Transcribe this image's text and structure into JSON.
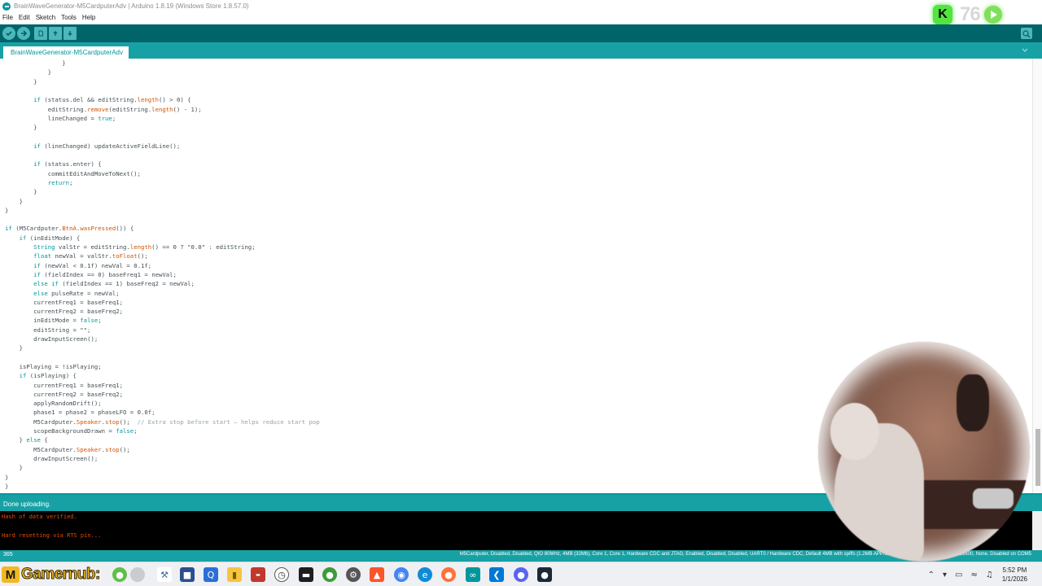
{
  "window": {
    "title": "BrainWaveGenerator-M5CardputerAdv | Arduino 1.8.19 (Windows Store 1.8.57.0)"
  },
  "menu": [
    "File",
    "Edit",
    "Sketch",
    "Tools",
    "Help"
  ],
  "overlay": {
    "badge_letter": "K",
    "counter": "76"
  },
  "toolbar": {
    "verify_icon": "check-icon",
    "upload_icon": "arrow-right-icon",
    "new_icon": "new-file-icon",
    "open_icon": "open-arrow-icon",
    "save_icon": "save-arrow-icon",
    "serial_icon": "magnifier-icon"
  },
  "tab": {
    "label": "BrainWaveGenerator-M5CardputerAdv"
  },
  "code": {
    "lines": [
      "                }",
      "            }",
      "        }",
      "",
      "        if (status.del && editString.length() > 0) {",
      "            editString.remove(editString.length() - 1);",
      "            lineChanged = true;",
      "        }",
      "",
      "        if (lineChanged) updateActiveFieldLine();",
      "",
      "        if (status.enter) {",
      "            commitEditAndMoveToNext();",
      "            return;",
      "        }",
      "    }",
      "}",
      "",
      "if (M5Cardputer.BtnA.wasPressed()) {",
      "    if (inEditMode) {",
      "        String valStr = editString.length() == 0 ? \"0.0\" : editString;",
      "        float newVal = valStr.toFloat();",
      "        if (newVal < 0.1f) newVal = 0.1f;",
      "        if (fieldIndex == 0) baseFreq1 = newVal;",
      "        else if (fieldIndex == 1) baseFreq2 = newVal;",
      "        else pulseRate = newVal;",
      "        currentFreq1 = baseFreq1;",
      "        currentFreq2 = baseFreq2;",
      "        inEditMode = false;",
      "        editString = \"\";",
      "        drawInputScreen();",
      "    }",
      "",
      "    isPlaying = !isPlaying;",
      "    if (isPlaying) {",
      "        currentFreq1 = baseFreq1;",
      "        currentFreq2 = baseFreq2;",
      "        applyRandomDrift();",
      "        phase1 = phase2 = phaseLFO = 0.0f;",
      "        M5Cardputer.Speaker.stop();  // Extra stop before start — helps reduce start pop",
      "        scopeBackgroundDrawn = false;",
      "    } else {",
      "        M5Cardputer.Speaker.stop();",
      "        drawInputScreen();",
      "    }",
      "}",
      "}"
    ]
  },
  "status": {
    "message": "Done uploading."
  },
  "console": {
    "lines": [
      "Hash of data verified.",
      "",
      "Hard resetting via RTS pin..."
    ]
  },
  "info": {
    "line_number": "365",
    "board": "M5Cardputer, Disabled, Disabled, QIO 80MHz, 4MB (32Mb), Core 1, Core 1, Hardware CDC and JTAG, Enabled, Disabled, Disabled, UART0 / Hardware CDC, Default 4MB with spiffs (1.2MB APP/1.5MB SPIFFS), 240MHz (WiFi), 921600, None, Disabled on COM5"
  },
  "taskbar": {
    "brand_letter": "M",
    "brand": "Gamernub:",
    "time": "5:52 PM",
    "date": "1/1/2026"
  },
  "colors": {
    "arduino_dark": "#006468",
    "arduino_teal": "#17a1a5",
    "keyword": "#00979c",
    "method": "#d35400",
    "console_text": "#e34c00",
    "brand_yellow": "#f2b821"
  }
}
